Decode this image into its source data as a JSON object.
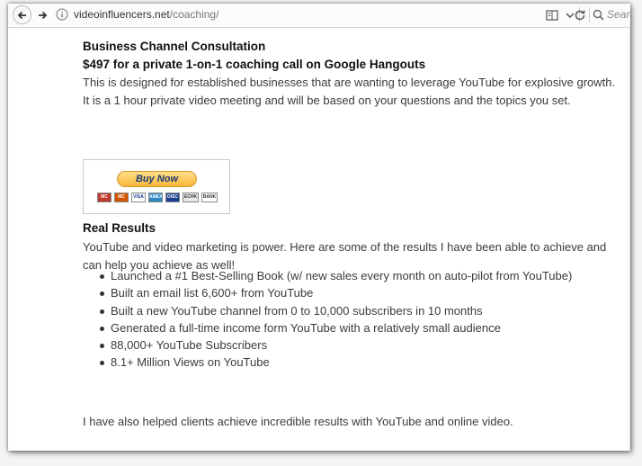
{
  "browser": {
    "url_host": "videoinfluencers.net",
    "url_path": "/coaching/",
    "search_placeholder": "Search"
  },
  "consultation": {
    "title": "Business Channel Consultation",
    "price_line": "$497 for a private 1-on-1 coaching call on Google Hangouts",
    "description": "This is designed for established businesses that are wanting to leverage YouTube for explosive growth. It is a 1 hour private video meeting and will be based on your questions and the topics you set."
  },
  "buy_button": {
    "label": "Buy Now",
    "cards": [
      "MC",
      "MC",
      "VISA",
      "AMEX",
      "DISC",
      "ECHK",
      "BANK"
    ]
  },
  "results": {
    "title": "Real Results",
    "intro": "YouTube and video marketing is power. Here are some of the results I have been able to achieve and can help you achieve as well!",
    "items": [
      "Launched a #1 Best-Selling Book (w/ new sales every month on auto-pilot from YouTube)",
      "Built an email list 6,600+ from YouTube",
      "Built a new YouTube channel from 0 to 10,000 subscribers in 10 months",
      "Generated a full-time income form YouTube with a relatively small audience",
      "88,000+ YouTube Subscribers",
      "8.1+ Million Views on YouTube"
    ],
    "closing": "I have also helped clients achieve incredible  results with YouTube and online video."
  },
  "colors": {
    "accent_button": "#f6b63a",
    "text": "#3b3b3b"
  }
}
